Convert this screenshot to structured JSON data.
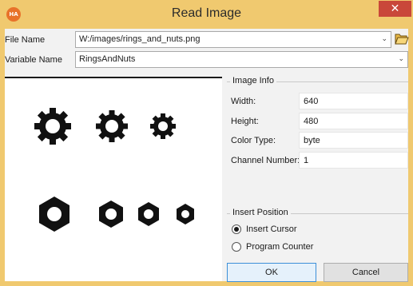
{
  "window": {
    "app_icon_text": "HA",
    "title": "Read Image",
    "close_symbol": "✕"
  },
  "file_row": {
    "label": "File Name",
    "value": "W:/images/rings_and_nuts.png",
    "dropdown_symbol": "⌄",
    "browse_icon": "folder-icon"
  },
  "variable_row": {
    "label": "Variable Name",
    "value": "RingsAndNuts",
    "dropdown_symbol": "⌄"
  },
  "image_info": {
    "group_title": "Image Info",
    "fields": [
      {
        "label": "Width:",
        "value": "640"
      },
      {
        "label": "Height:",
        "value": "480"
      },
      {
        "label": "Color Type:",
        "value": "byte"
      },
      {
        "label": "Channel Number:",
        "value": "1"
      }
    ]
  },
  "insert_position": {
    "group_title": "Insert Position",
    "options": [
      {
        "label": "Insert Cursor",
        "selected": true
      },
      {
        "label": "Program Counter",
        "selected": false
      }
    ]
  },
  "buttons": {
    "ok": "OK",
    "cancel": "Cancel"
  },
  "colors": {
    "title_bar": "#f0c96f",
    "close_button": "#c9473a",
    "app_icon": "#e8722a",
    "default_button_border": "#3c8fd8"
  }
}
